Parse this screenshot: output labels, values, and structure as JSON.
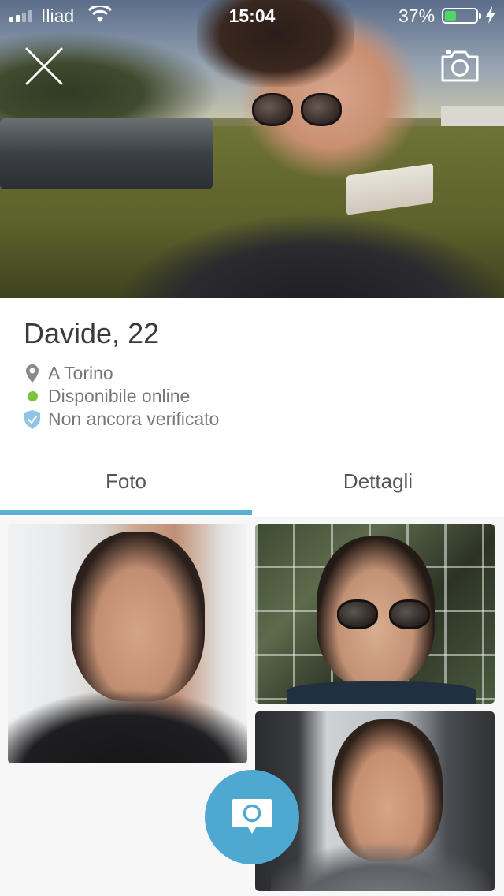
{
  "status_bar": {
    "carrier": "Iliad",
    "time": "15:04",
    "battery_percent": "37%",
    "battery_level": 0.37,
    "battery_color": "#4cd964"
  },
  "hero": {
    "close_icon": "close-icon",
    "camera_icon": "camera-icon"
  },
  "profile": {
    "name": "Davide, 22",
    "location": "A Torino",
    "online_status": "Disponibile online",
    "verification": "Non ancora verificato",
    "online_color": "#7cc53a",
    "verified_icon_color": "#8fc4e6"
  },
  "tabs": [
    {
      "label": "Foto",
      "active": true
    },
    {
      "label": "Dettagli",
      "active": false
    }
  ],
  "accent_color": "#5ab0d4",
  "chat_button": {
    "icon": "chat-bubble-icon",
    "color": "#4fa8cf"
  }
}
